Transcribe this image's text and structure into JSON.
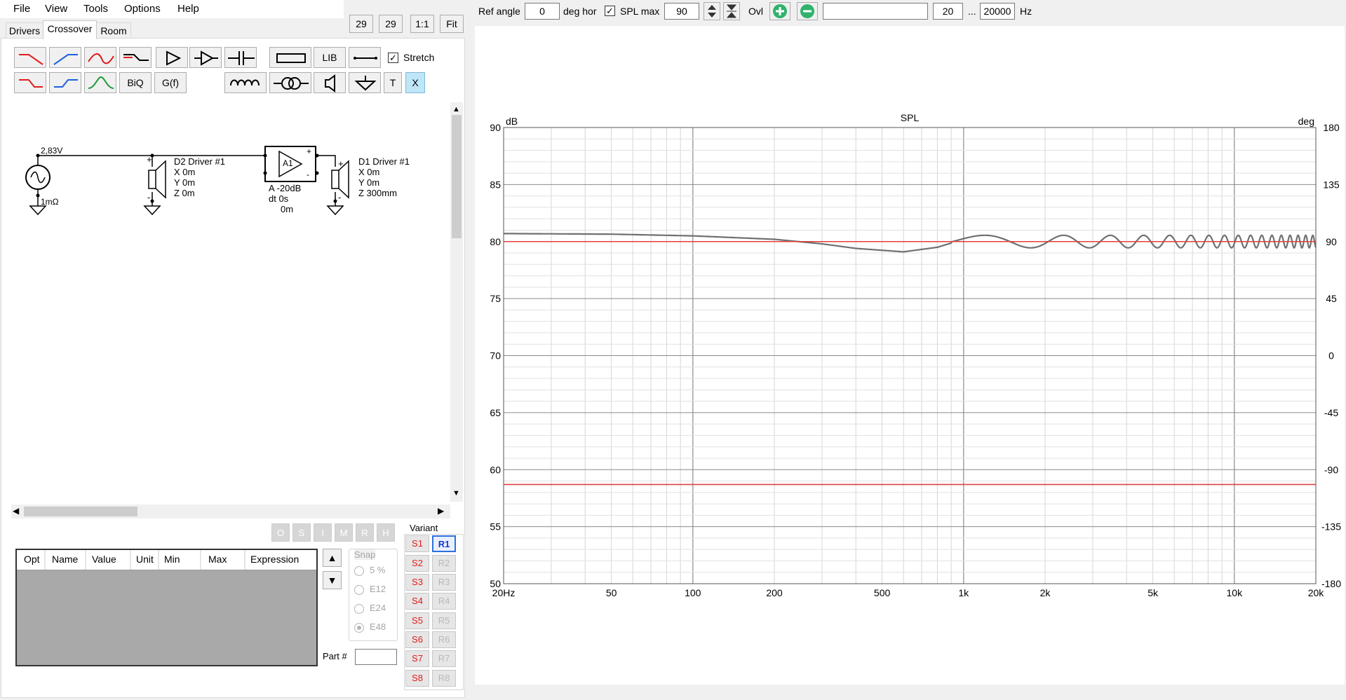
{
  "menu": {
    "file": "File",
    "view": "View",
    "tools": "Tools",
    "options": "Options",
    "help": "Help"
  },
  "zoom_buttons": {
    "a": "29",
    "b": "29",
    "one_to_one": "1:1",
    "fit": "Fit"
  },
  "tabs": {
    "drivers": "Drivers",
    "crossover": "Crossover",
    "room": "Room"
  },
  "toolbar": {
    "lib": "LIB",
    "biq": "BiQ",
    "gf": "G(f)",
    "t": "T",
    "x": "X",
    "stretch": "Stretch"
  },
  "top_controls": {
    "ref_angle_label": "Ref angle",
    "ref_angle_value": "0",
    "deg_hor": "deg hor",
    "spl_max_label": "SPL max",
    "spl_max_value": "90",
    "ovl": "Ovl",
    "freq_from": "20",
    "ellipsis": "...",
    "freq_to": "20000",
    "hz": "Hz"
  },
  "schematic": {
    "source_voltage": "2,83V",
    "source_r": "1mΩ",
    "d2_name": "D2 Driver #1",
    "d2_x": "X 0m",
    "d2_y": "Y 0m",
    "d2_z": "Z 0m",
    "amp_name": "A1",
    "amp_gain": "A -20dB",
    "amp_dt": "dt 0s",
    "amp_dist": "0m",
    "d1_name": "D1 Driver #1",
    "d1_x": "X 0m",
    "d1_y": "Y 0m",
    "d1_z": "Z 300mm"
  },
  "opt_buttons": [
    "O",
    "S",
    "I",
    "M",
    "R",
    "H"
  ],
  "grid_columns": {
    "opt": "Opt",
    "name": "Name",
    "value": "Value",
    "unit": "Unit",
    "min": "Min",
    "max": "Max",
    "expression": "Expression"
  },
  "snap": {
    "title": "Snap",
    "options": [
      "5 %",
      "E12",
      "E24",
      "E48"
    ],
    "selected": "E48"
  },
  "part_label": "Part #",
  "variant": {
    "title": "Variant",
    "s": [
      "S1",
      "S2",
      "S3",
      "S4",
      "S5",
      "S6",
      "S7",
      "S8"
    ],
    "r": [
      "R1",
      "R2",
      "R3",
      "R4",
      "R5",
      "R6",
      "R7",
      "R8"
    ],
    "active": "R1"
  },
  "colors": {
    "red": "#e21c1c",
    "blue": "#1f5fe0",
    "green": "#1f9a3a",
    "curve": "#707070",
    "ref_line": "#e04040",
    "accent_green": "#2fb36c"
  },
  "chart_data": {
    "type": "line",
    "title": "SPL",
    "ylabel": "dB",
    "y2label": "deg",
    "x_scale": "log",
    "xlim": [
      20,
      20000
    ],
    "ylim": [
      50,
      90
    ],
    "y2lim": [
      -180,
      180
    ],
    "x_ticks": [
      "20Hz",
      "50",
      "100",
      "200",
      "500",
      "1k",
      "2k",
      "5k",
      "10k",
      "20k"
    ],
    "y_ticks": [
      "90",
      "85",
      "80",
      "75",
      "70",
      "65",
      "60",
      "55",
      "50"
    ],
    "y2_ticks": [
      "180",
      "135",
      "90",
      "45",
      "0",
      "-45",
      "-90",
      "-135",
      "-180"
    ],
    "grid": true,
    "series": [
      {
        "style": "gray-curve",
        "x": [
          20,
          50,
          100,
          200,
          300,
          400,
          600,
          800,
          1000,
          1200,
          1500,
          2000,
          2500,
          3000,
          4000,
          5000,
          7000,
          10000,
          15000,
          20000
        ],
        "y": [
          80.7,
          80.65,
          80.5,
          80.2,
          79.8,
          79.4,
          79.1,
          79.5,
          80.2,
          80.6,
          80.2,
          79.6,
          80.3,
          79.6,
          80.3,
          79.7,
          80.2,
          79.8,
          80.1,
          79.8
        ]
      },
      {
        "style": "red-line",
        "x": [
          20,
          20000
        ],
        "y": [
          80,
          80
        ]
      },
      {
        "style": "red-line-phase",
        "x": [
          20,
          20000
        ],
        "y": [
          58.7,
          58.7
        ]
      }
    ]
  }
}
